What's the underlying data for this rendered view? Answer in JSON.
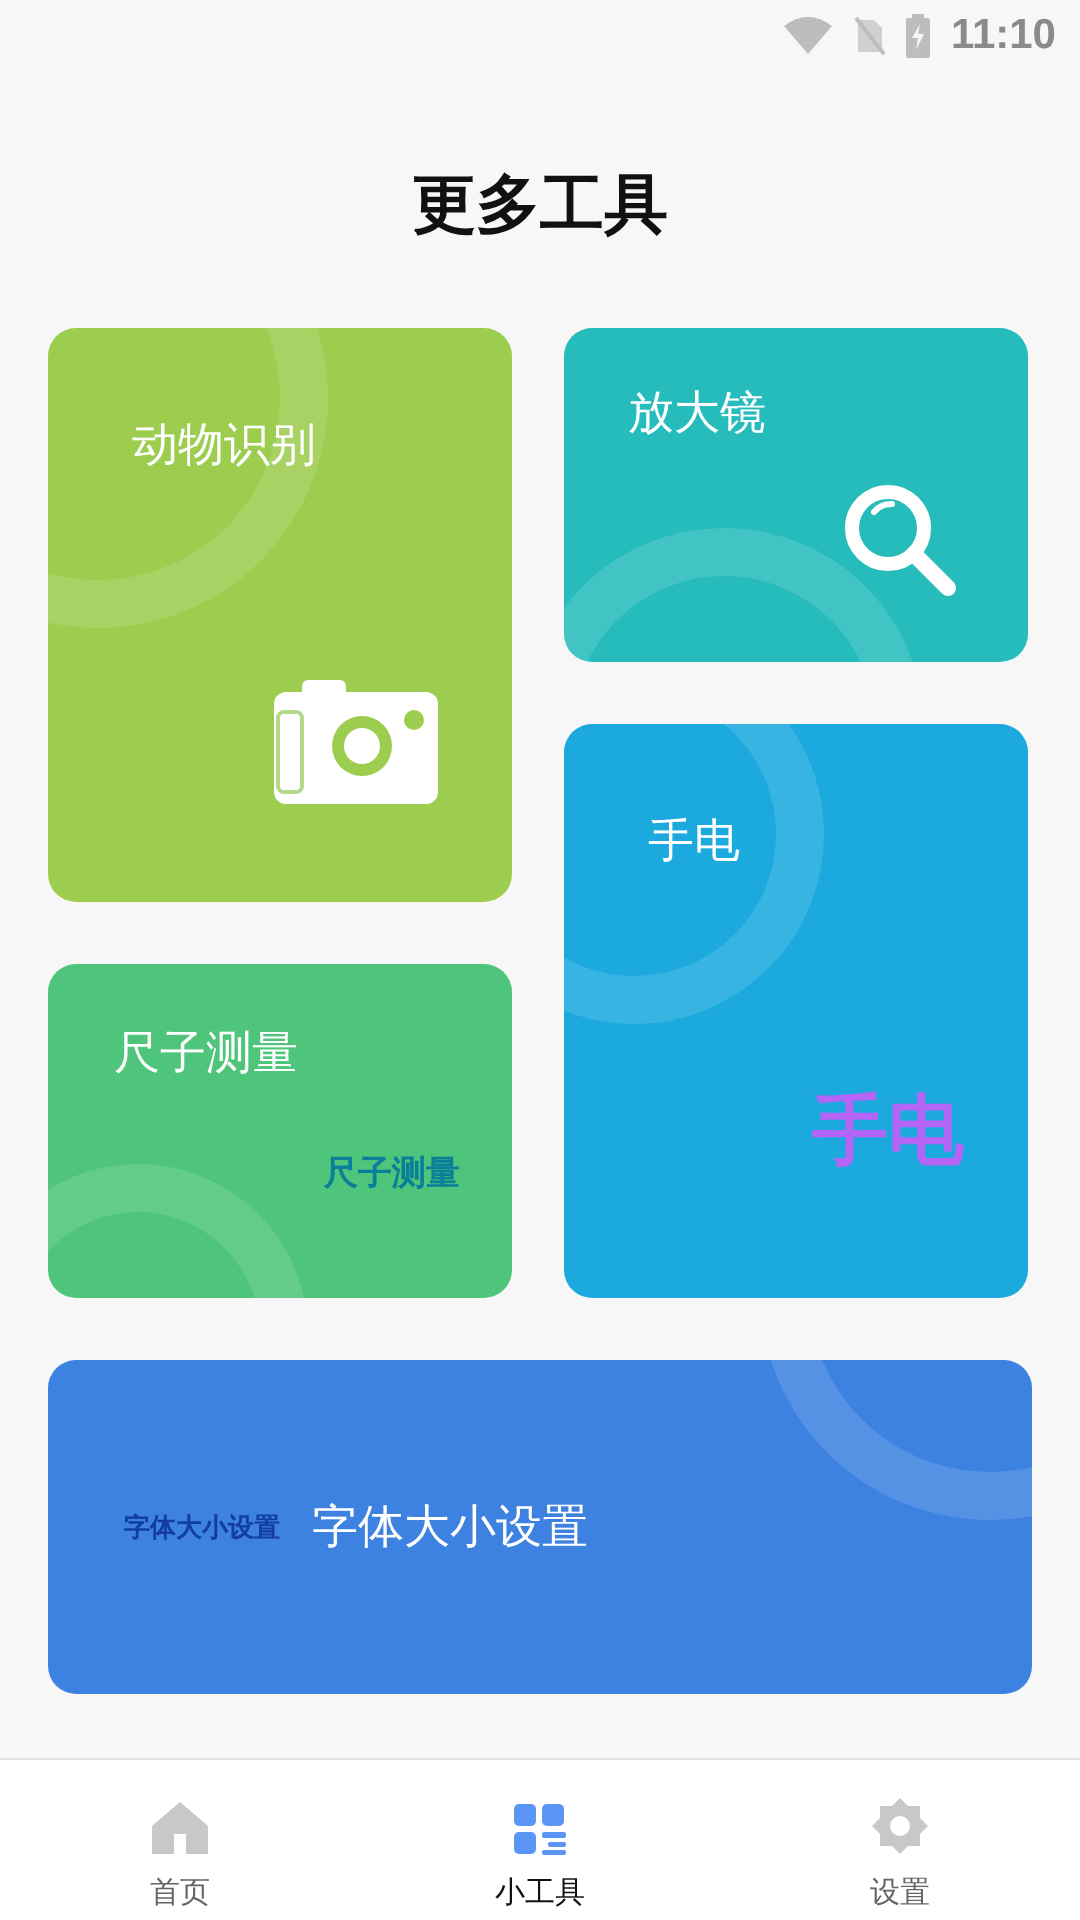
{
  "status_bar": {
    "time": "11:10"
  },
  "title": "更多工具",
  "tools": [
    {
      "label": "动物识别",
      "color": "#9ccd4e"
    },
    {
      "label": "放大镜",
      "color": "#27bcbc"
    },
    {
      "label": "尺子测量",
      "color": "#4ec57a",
      "icon_text": "尺子测量"
    },
    {
      "label": "手电",
      "color": "#1ba9de",
      "icon_text": "手电"
    }
  ],
  "wide_tool": {
    "label": "字体大小设置",
    "color": "#3d82e0",
    "icon_text": "字体大小设置"
  },
  "nav": [
    {
      "label": "首页",
      "selected": false
    },
    {
      "label": "小工具",
      "selected": true
    },
    {
      "label": "设置",
      "selected": false
    }
  ]
}
